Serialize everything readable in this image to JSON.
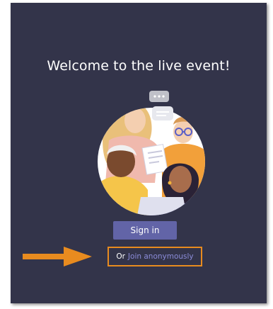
{
  "header": {
    "title": "Welcome to the live event!"
  },
  "illustration": {
    "icon": "people-group-illustration",
    "accent_color": "#ffffff"
  },
  "actions": {
    "sign_in_label": "Sign in",
    "or_label": "Or",
    "join_anonymously_label": "Join anonymously"
  },
  "annotation": {
    "arrow_icon": "arrow-right-icon",
    "highlight_color": "#e88b1f"
  },
  "colors": {
    "background": "#33344a",
    "primary": "#6264a7",
    "link": "#8b8cd9"
  }
}
